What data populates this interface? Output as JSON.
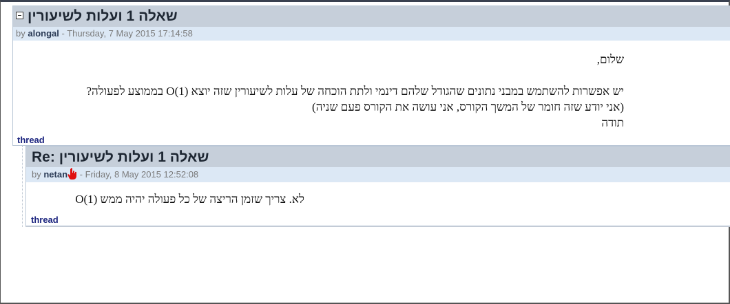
{
  "posts": [
    {
      "subject": "שאלה 1 ועלות לשיעורין",
      "author": "alongal",
      "by_label": "by",
      "date": "Thursday, 7 May 2015 17:14:58",
      "body_lines": [
        "שלום,",
        "",
        "יש אפשרות להשתמש במבני נתונים שהגודל שלהם דינמי ולתת הוכחה של עלות לשיעורין שזה יוצא O(1) בממוצע לפעולה?",
        "(אני יודע שזה חומר של המשך הקורס, אני עושה את הקורס פעם שניה)",
        "תודה"
      ],
      "thread_link": "thread"
    },
    {
      "subject": "Re: שאלה 1 ועלות לשיעורין",
      "author": "netan",
      "by_label": "by",
      "date": "Friday, 8 May 2015 12:52:08",
      "body": "לא. צריך שזמן הריצה של כל פעולה יהיה ממש O(1)",
      "thread_link": "thread"
    }
  ],
  "icons": {
    "collapse": "collapse-minus-icon",
    "cursor": "hand-cursor-icon"
  },
  "colors": {
    "subject_bg": "#c6cfda",
    "meta_bg": "#dce8f5",
    "link": "#1a237e",
    "cursor": "#e01010"
  }
}
